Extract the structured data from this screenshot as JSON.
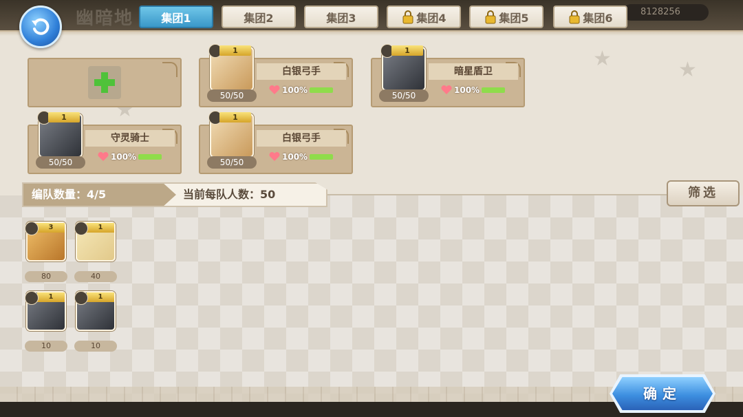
{
  "header": {
    "title": "幽暗地",
    "gold": "8128256"
  },
  "tabs": [
    {
      "label": "集团1",
      "active": true,
      "locked": false
    },
    {
      "label": "集团2",
      "active": false,
      "locked": false
    },
    {
      "label": "集团3",
      "active": false,
      "locked": false
    },
    {
      "label": "集团4",
      "active": false,
      "locked": true
    },
    {
      "label": "集团5",
      "active": false,
      "locked": true
    },
    {
      "label": "集团6",
      "active": false,
      "locked": true
    }
  ],
  "formation": [
    {
      "empty": true
    },
    {
      "name": "白银弓手",
      "level": "1",
      "troops": "50/50",
      "hp": "100%",
      "hp_fraction": 1.0,
      "portrait": "archer"
    },
    {
      "name": "暗星盾卫",
      "level": "1",
      "troops": "50/50",
      "hp": "100%",
      "hp_fraction": 1.0,
      "portrait": "knight"
    },
    {
      "name": "守灵骑士",
      "level": "1",
      "troops": "50/50",
      "hp": "100%",
      "hp_fraction": 1.0,
      "portrait": "knight"
    },
    {
      "name": "白银弓手",
      "level": "1",
      "troops": "50/50",
      "hp": "100%",
      "hp_fraction": 1.0,
      "portrait": "archer"
    }
  ],
  "info": {
    "team_count": "编队数量：4/5",
    "per_team": "当前每队人数：50"
  },
  "filter_label": "筛选",
  "units": [
    {
      "level": "3",
      "count": "80",
      "portrait": "gold-helm"
    },
    {
      "level": "1",
      "count": "40",
      "portrait": "blonde"
    },
    {
      "level": "1",
      "count": "10",
      "portrait": "knight"
    },
    {
      "level": "1",
      "count": "10",
      "portrait": "knight"
    }
  ],
  "confirm_label": "确定",
  "colors": {
    "active_tab": "#3a98c9",
    "hp_fill": "#8fdc4b",
    "confirm": "#3d8fe0"
  }
}
